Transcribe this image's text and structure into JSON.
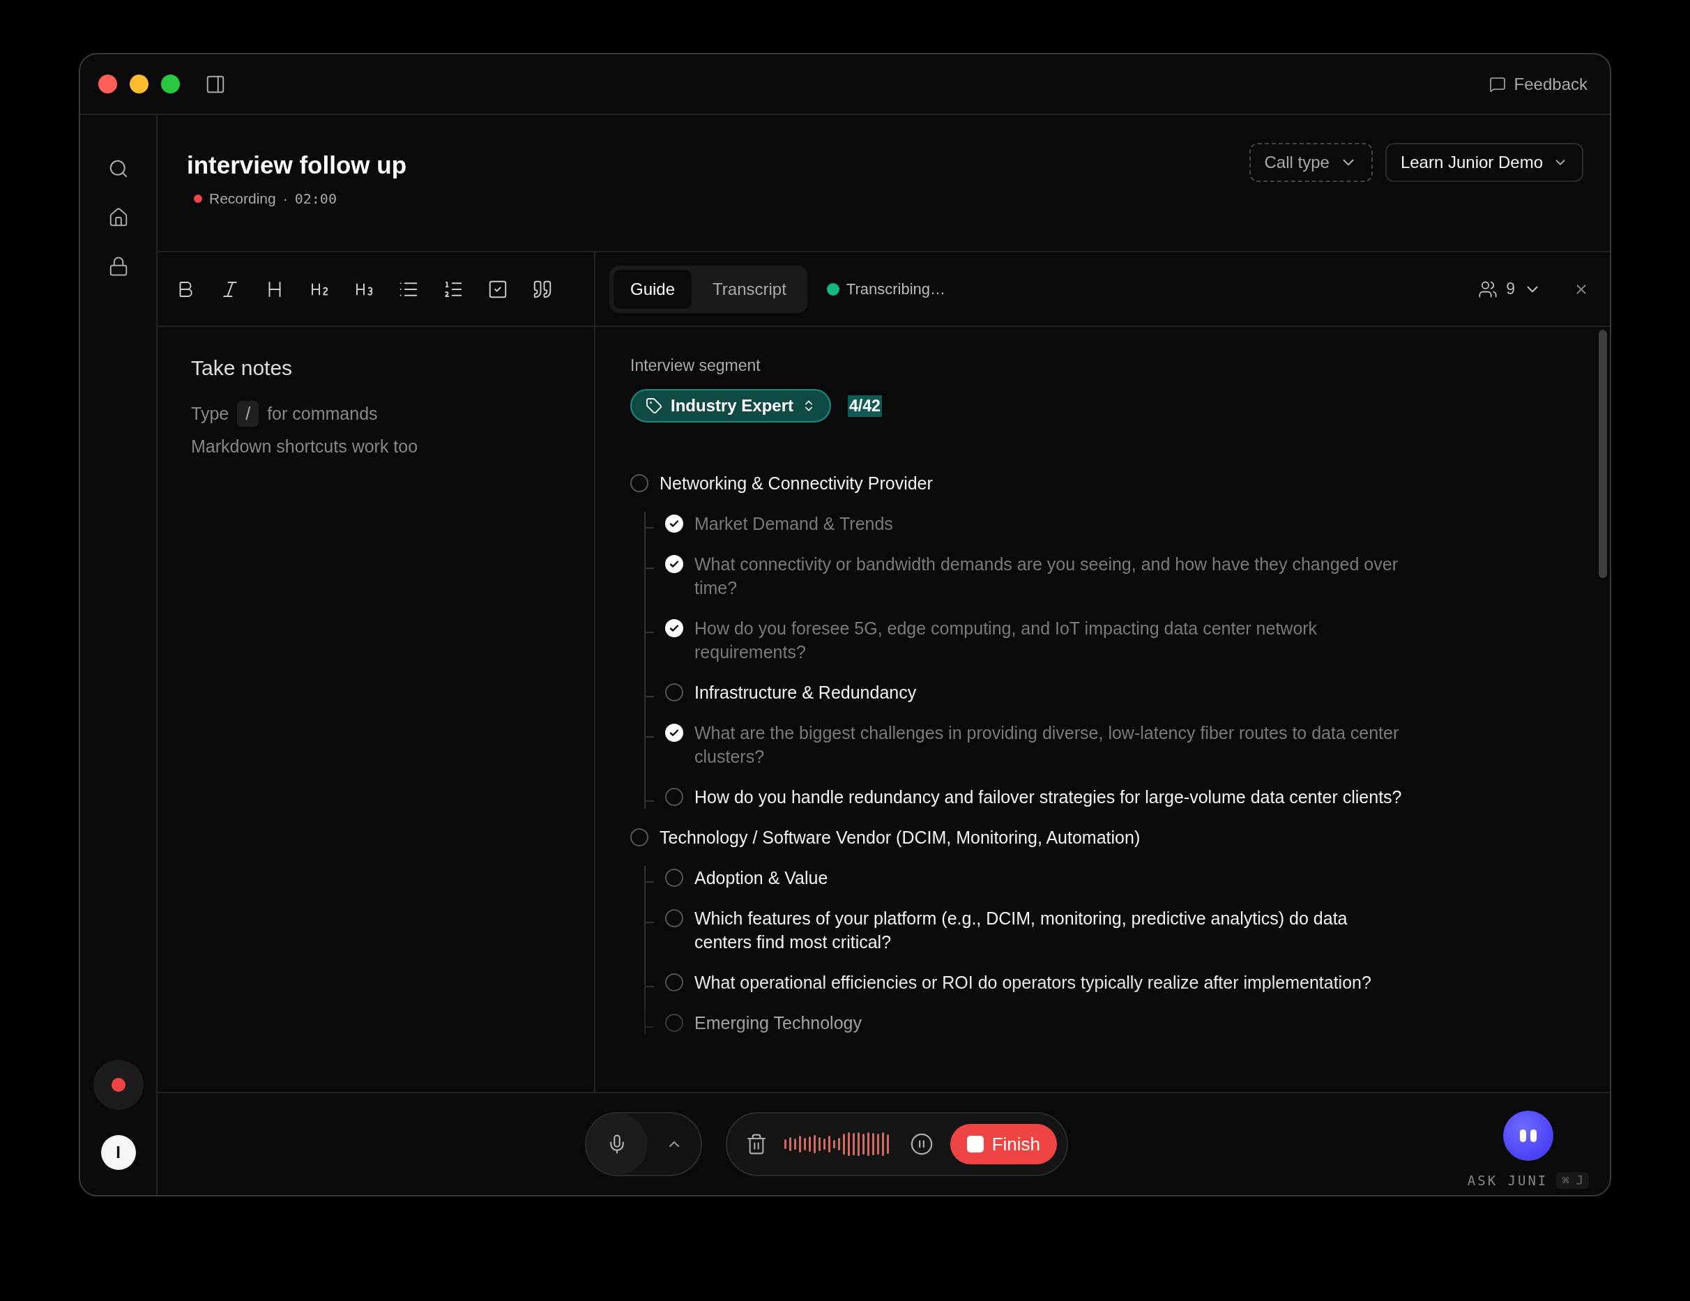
{
  "window": {
    "feedback": "Feedback"
  },
  "note": {
    "title": "interview follow up",
    "status": "Recording",
    "separator": "·",
    "time": "02:00"
  },
  "header_controls": {
    "call_type": "Call type",
    "workspace": "Learn Junior Demo"
  },
  "editor": {
    "title_placeholder": "Take notes",
    "hint_before": "Type",
    "hint_key": "/",
    "hint_after": "for commands",
    "hint_second": "Markdown shortcuts work too"
  },
  "panel": {
    "tabs": [
      {
        "label": "Guide",
        "selected": true
      },
      {
        "label": "Transcript",
        "selected": false
      }
    ],
    "status": "Transcribing…",
    "participants": "9"
  },
  "guide": {
    "heading": "Interview segment",
    "segment": "Industry Expert",
    "progress": "4/42",
    "sections": [
      {
        "text": "Networking & Connectivity Provider",
        "checked": false,
        "children": [
          {
            "text": "Market Demand & Trends",
            "checked": true
          },
          {
            "text": "What connectivity or bandwidth demands are you seeing, and how have they changed over time?",
            "checked": true
          },
          {
            "text": "How do you foresee 5G, edge computing, and IoT impacting data center network requirements?",
            "checked": true
          },
          {
            "text": "Infrastructure & Redundancy",
            "checked": false
          },
          {
            "text": "What are the biggest challenges in providing diverse, low-latency fiber routes to data center clusters?",
            "checked": true
          },
          {
            "text": "How do you handle redundancy and failover strategies for large-volume data center clients?",
            "checked": false
          }
        ]
      },
      {
        "text": "Technology / Software Vendor (DCIM, Monitoring, Automation)",
        "checked": false,
        "children": [
          {
            "text": "Adoption & Value",
            "checked": false
          },
          {
            "text": "Which features of your platform (e.g., DCIM, monitoring, predictive analytics) do data centers find most critical?",
            "checked": false
          },
          {
            "text": "What operational efficiencies or ROI do operators typically realize after implementation?",
            "checked": false
          },
          {
            "text": "Emerging Technology",
            "checked": false
          }
        ]
      }
    ]
  },
  "recorder": {
    "finish": "Finish"
  },
  "assistant": {
    "label": "ASK JUNI",
    "shortcut": "⌘ J"
  },
  "user": {
    "initial": "I"
  }
}
